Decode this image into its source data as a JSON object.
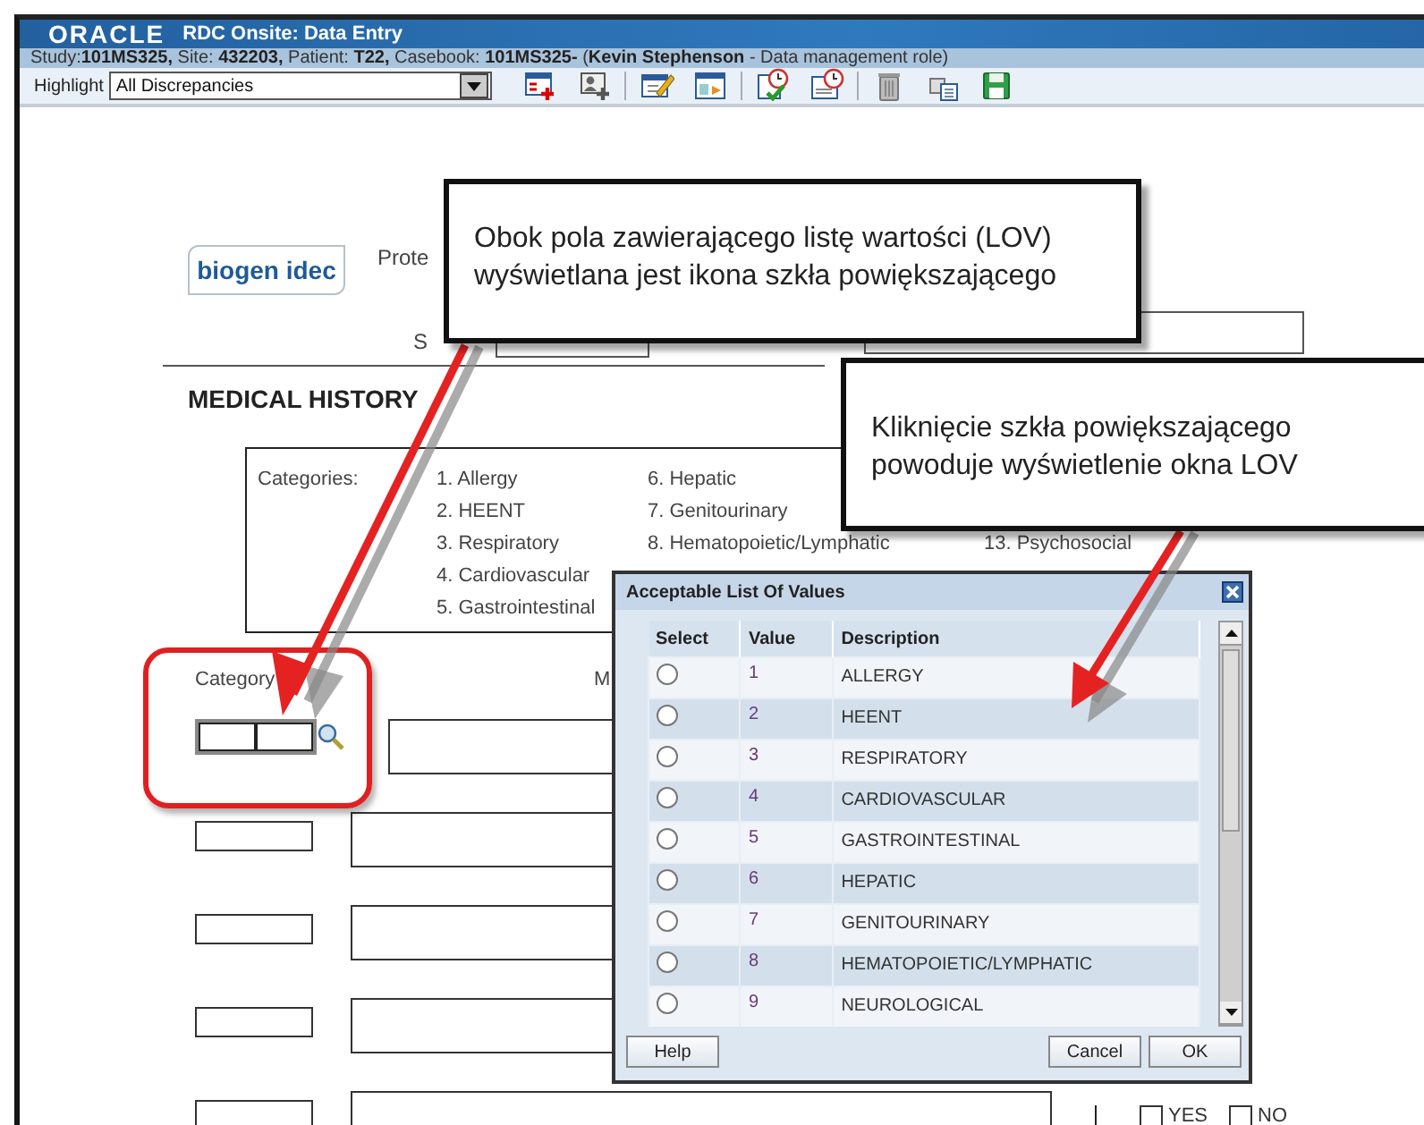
{
  "window": {
    "logo": "ORACLE",
    "title": "RDC Onsite: Data Entry"
  },
  "context": "Study:**101MS325,** Site: **432203,** Patient: **T22,** Casebook: **101MS325-** (**Kevin Stephenson** - Data management role)",
  "toolbar": {
    "highlight_label": "Highlight",
    "highlight_value": "All Discrepancies"
  },
  "form": {
    "logo": "biogen idec",
    "header_labels": [
      "Prote",
      "S"
    ],
    "section_title": "MEDICAL HISTORY",
    "categories_label": "Categories:",
    "category_columns": [
      [
        "1. Allergy",
        "2. HEENT",
        "3. Respiratory",
        "4. Cardiovascular",
        "5. Gastrointestinal"
      ],
      [
        "6. Hepatic",
        "7. Genitourinary",
        "8. Hematopoietic/Lymphatic"
      ],
      [
        "13. Psychosocial"
      ]
    ],
    "column_labels": [
      "Category",
      "M"
    ],
    "rows": [
      {
        "kind": "lov"
      },
      {
        "kind": "plain"
      },
      {
        "kind": "plain"
      },
      {
        "kind": "plain"
      },
      {
        "kind": "plain",
        "options": [
          {
            "label": "YES",
            "checked": false
          },
          {
            "label": "NO",
            "checked": false
          }
        ]
      }
    ]
  },
  "dialog": {
    "title": "Acceptable List Of Values",
    "columns": [
      "Select",
      "Value",
      "Description"
    ],
    "rows": [
      {
        "value": "1",
        "description": "ALLERGY",
        "selected": false
      },
      {
        "value": "2",
        "description": "HEENT",
        "selected": false
      },
      {
        "value": "3",
        "description": "RESPIRATORY",
        "selected": false
      },
      {
        "value": "4",
        "description": "CARDIOVASCULAR",
        "selected": false
      },
      {
        "value": "5",
        "description": "GASTROINTESTINAL",
        "selected": false
      },
      {
        "value": "6",
        "description": "HEPATIC",
        "selected": false
      },
      {
        "value": "7",
        "description": "GENITOURINARY",
        "selected": false
      },
      {
        "value": "8",
        "description": "HEMATOPOIETIC/LYMPHATIC",
        "selected": false
      },
      {
        "value": "9",
        "description": "NEUROLOGICAL",
        "selected": false
      }
    ],
    "buttons": [
      "Help",
      "Cancel",
      "OK"
    ]
  },
  "callouts": [
    {
      "text": "Obok pola zawierającego listę wartości (LOV) wyświetlana jest ikona szkła powiększającego"
    },
    {
      "text": "Kliknięcie szkła powiększającego powoduje wyświetlenie okna LOV"
    }
  ]
}
